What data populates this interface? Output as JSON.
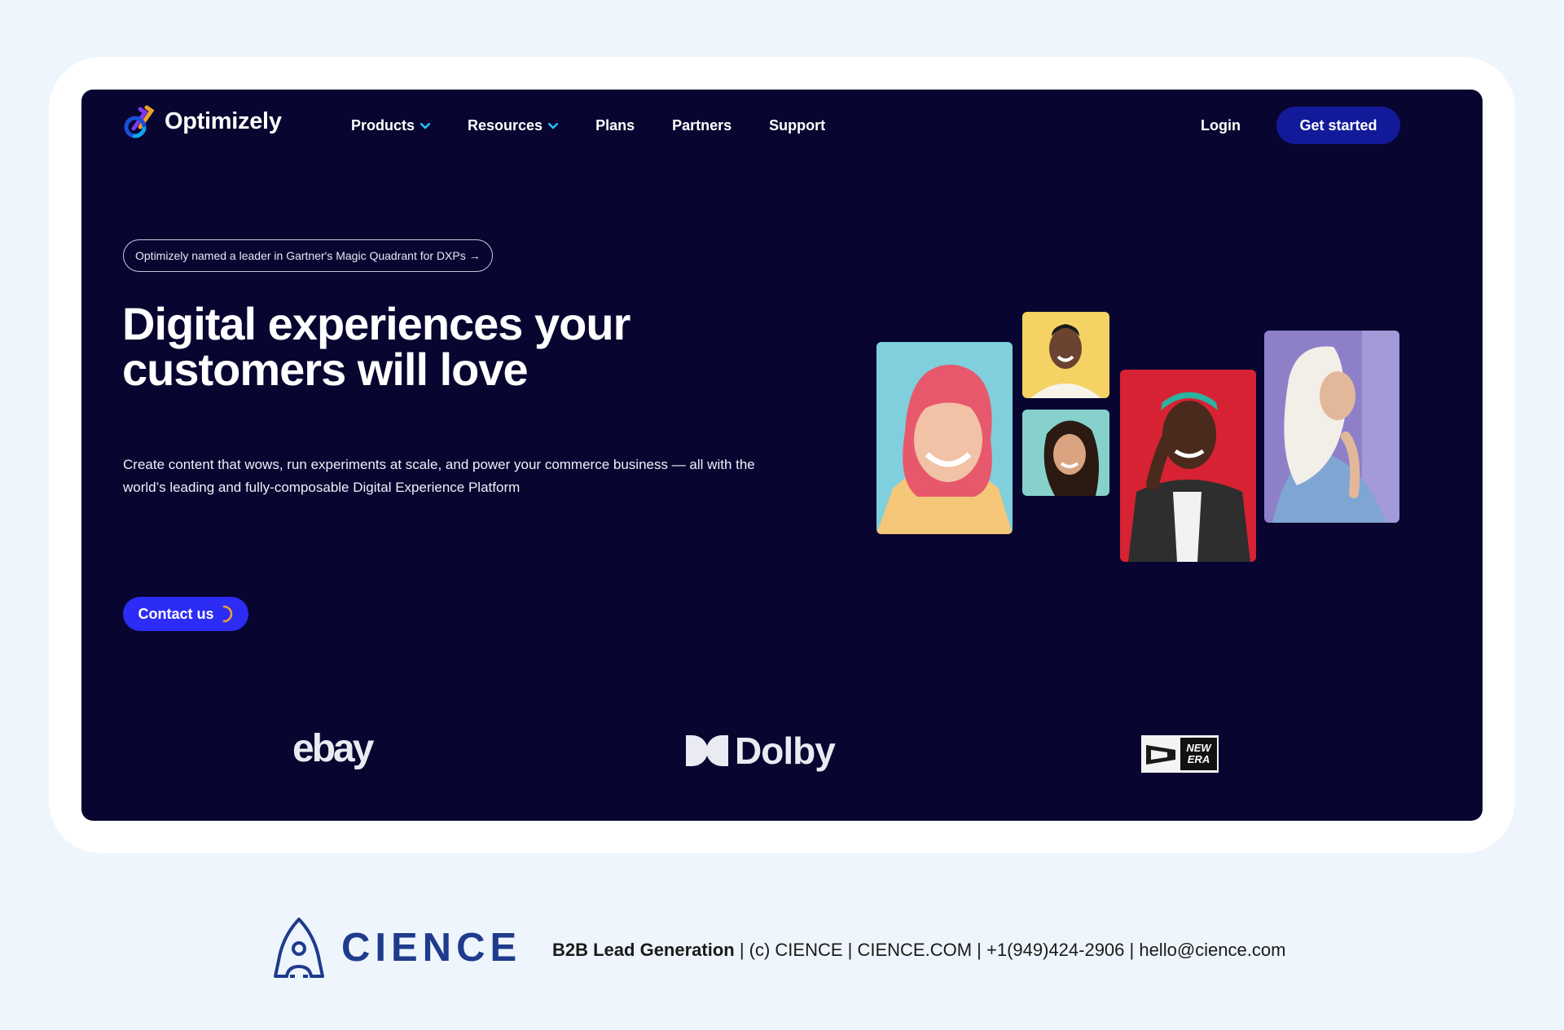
{
  "site": {
    "brand": "Optimizely",
    "nav": [
      {
        "label": "Products",
        "dropdown": true
      },
      {
        "label": "Resources",
        "dropdown": true
      },
      {
        "label": "Plans",
        "dropdown": false
      },
      {
        "label": "Partners",
        "dropdown": false
      },
      {
        "label": "Support",
        "dropdown": false
      }
    ],
    "login_label": "Login",
    "get_started_label": "Get started",
    "badge": "Optimizely named a leader in Gartner's Magic Quadrant for DXPs →",
    "headline": "Digital experiences your customers will love",
    "subtext": "Create content that wows, run experiments at scale, and power your commerce business — all with the world’s leading and fully-composable Digital Experience Platform",
    "contact_label": "Contact us",
    "customer_logos": [
      "ebay",
      "Dolby",
      "NEW ERA"
    ]
  },
  "footer": {
    "company": "CIENCE",
    "tagline": "B2B Lead Generation",
    "details": " | (c) CIENCE | CIENCE.COM | +1(949)424-2906 | hello@cience.com"
  },
  "colors": {
    "page_bg": "#eef5fc",
    "site_bg": "#080530",
    "cta_dark": "#131a9a",
    "cta_blue": "#2c2cf5",
    "cience_blue": "#1e3b8c"
  }
}
